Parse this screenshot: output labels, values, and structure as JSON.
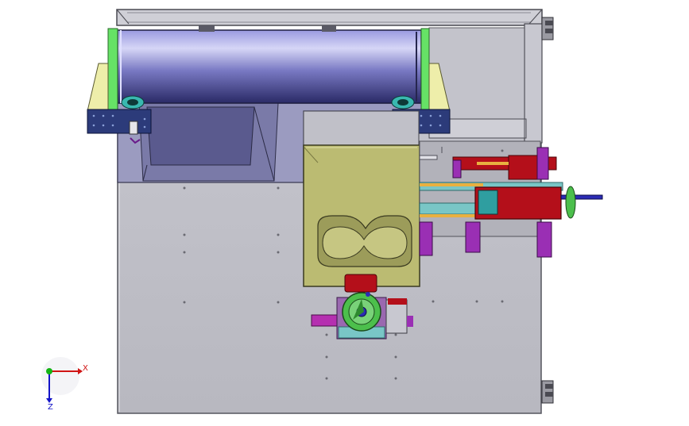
{
  "viewport": {
    "background": "#ffffff",
    "colors": {
      "plate": "#bfbfc6",
      "plate_edge": "#55565e",
      "drum_light": "#c9c9f0",
      "drum_dark": "#3c3c78",
      "bracket_yellow": "#eeeeaa",
      "green_strip": "#66e266",
      "block_blue": "#2c3b7a",
      "olive_block": "#bbbb72",
      "purple": "#9a2fb4",
      "red": "#b40f1a",
      "green_wheel": "#4cbf4c",
      "teal": "#79c6c6",
      "bolt_cyan": "#39b8b0"
    }
  },
  "triad": {
    "x_label": "X",
    "z_label": "Z",
    "x_color": "#d01414",
    "y_color": "#14b414",
    "z_color": "#1414c8"
  }
}
